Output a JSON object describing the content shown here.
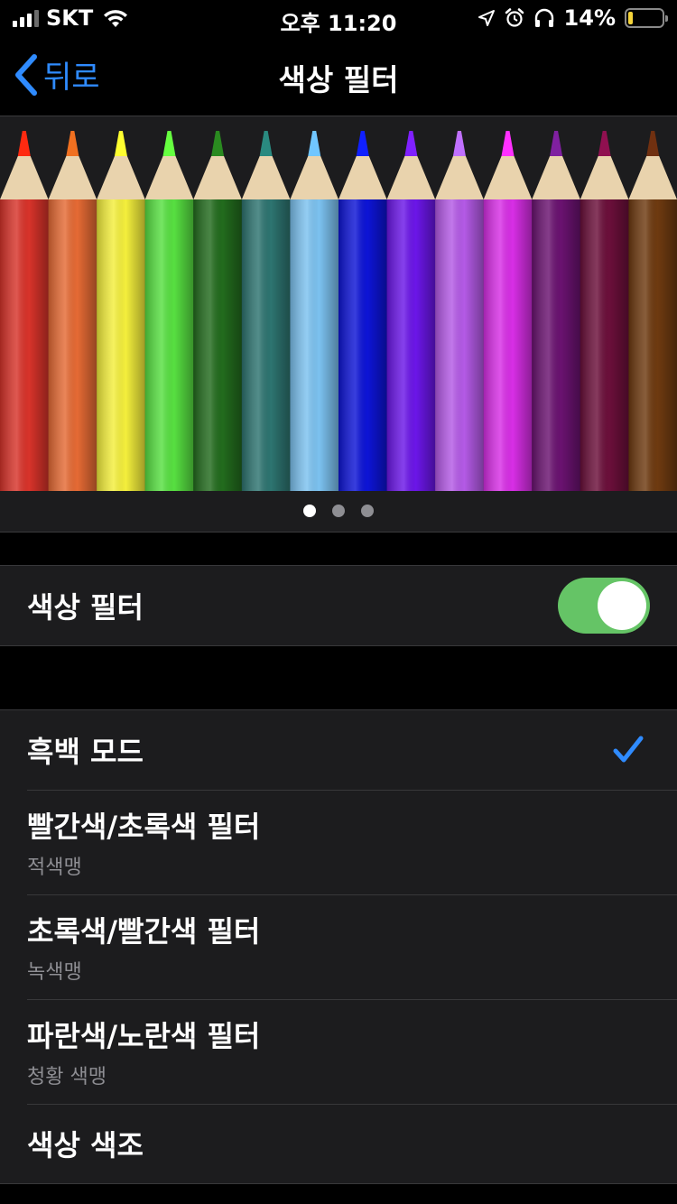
{
  "status_bar": {
    "carrier": "SKT",
    "time": "오후 11:20",
    "battery_percent": "14%",
    "battery_level": 0.14,
    "icons": [
      "signal-icon",
      "wifi-icon",
      "location-icon",
      "alarm-icon",
      "headphones-icon",
      "battery-icon"
    ]
  },
  "nav": {
    "back_label": "뒤로",
    "title": "색상 필터"
  },
  "preview": {
    "pencil_colors": [
      "#d8332a",
      "#e56a34",
      "#f4ef3c",
      "#57e041",
      "#226b1d",
      "#2d7470",
      "#7cc2f0",
      "#0d14d6",
      "#6b16e8",
      "#b45ae6",
      "#d82ee6",
      "#6a1270",
      "#6b0f3a",
      "#6e3a10"
    ],
    "tip_colors": [
      "#ff2a10",
      "#f07020",
      "#ffff30",
      "#66ff40",
      "#2a8a20",
      "#2a8a80",
      "#70c6ff",
      "#1020ff",
      "#8020ff",
      "#c070ff",
      "#ff30ff",
      "#8020a0",
      "#901050",
      "#703010"
    ],
    "wood_color": "#e9d3ad",
    "pages": 3,
    "active_page": 0
  },
  "toggle_group": {
    "label": "색상 필터",
    "enabled": true,
    "on_color": "#65c466"
  },
  "filters": [
    {
      "title": "흑백 모드",
      "subtitle": "",
      "selected": true
    },
    {
      "title": "빨간색/초록색 필터",
      "subtitle": "적색맹",
      "selected": false
    },
    {
      "title": "초록색/빨간색 필터",
      "subtitle": "녹색맹",
      "selected": false
    },
    {
      "title": "파란색/노란색 필터",
      "subtitle": "청황 색맹",
      "selected": false
    },
    {
      "title": "색상 색조",
      "subtitle": "",
      "selected": false
    }
  ],
  "accent_color": "#2f8bff"
}
